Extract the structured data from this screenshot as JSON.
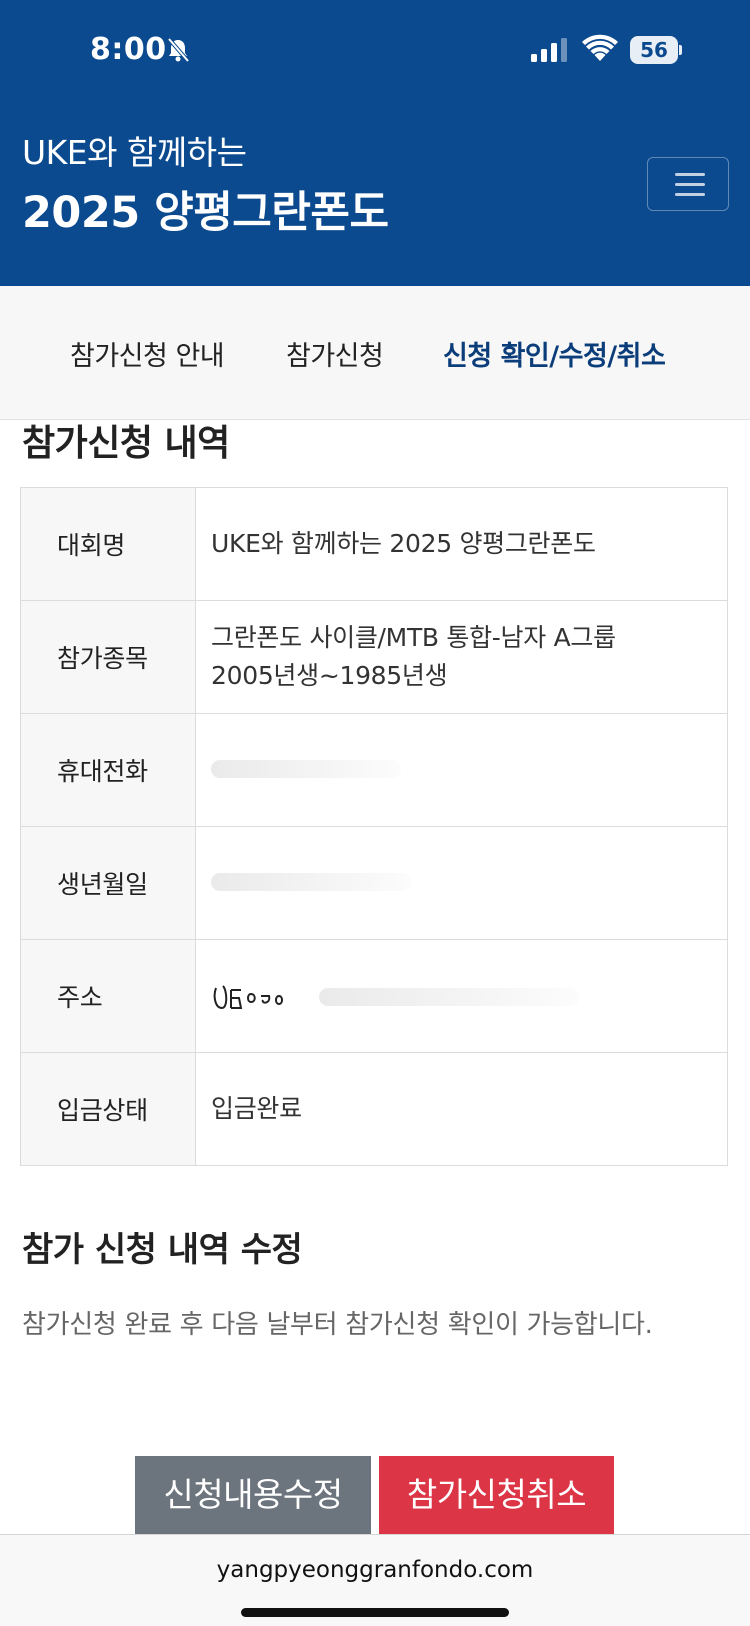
{
  "status_bar": {
    "time": "8:00",
    "battery": "56"
  },
  "header": {
    "subtitle": "UKE와 함께하는",
    "title": "2025 양평그란폰도"
  },
  "tabs": [
    {
      "label": "참가신청 안내"
    },
    {
      "label": "참가신청"
    },
    {
      "label": "신청 확인/수정/취소"
    }
  ],
  "registration": {
    "section_title": "참가신청 내역",
    "rows": [
      {
        "key": "대회명",
        "value": "UKE와 함께하는 2025 양평그란폰도"
      },
      {
        "key": "참가종목",
        "value": "그란폰도 사이클/MTB 통합-남자 A그룹",
        "value2": "2005년생~1985년생"
      },
      {
        "key": "휴대전화",
        "value": ""
      },
      {
        "key": "생년월일",
        "value": ""
      },
      {
        "key": "주소",
        "value": ""
      },
      {
        "key": "입금상태",
        "value": "입금완료"
      }
    ]
  },
  "edit_section": {
    "title": "참가 신청 내역 수정",
    "notice": "참가신청 완료 후 다음 날부터 참가신청 확인이 가능합니다."
  },
  "buttons": {
    "edit": "신청내용수정",
    "cancel": "참가신청취소"
  },
  "browser": {
    "url": "yangpyeonggranfondo.com"
  }
}
